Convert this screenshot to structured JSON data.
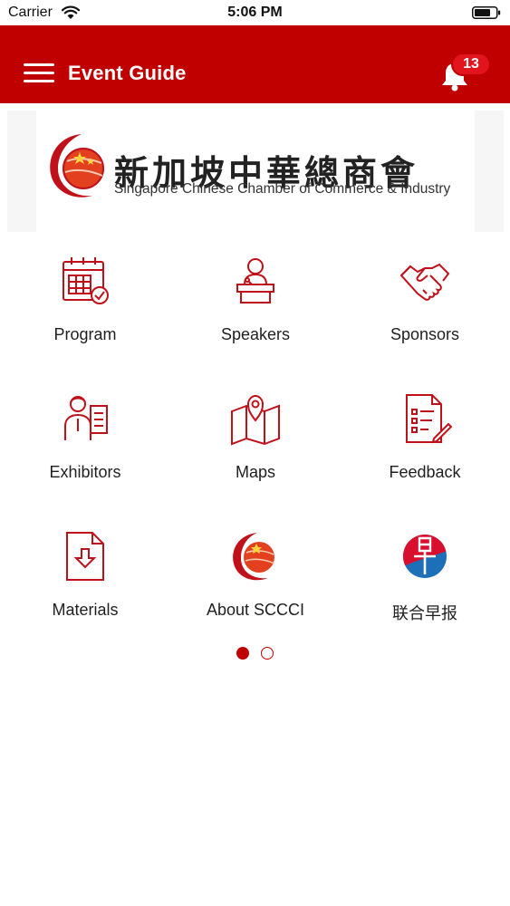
{
  "status_bar": {
    "carrier": "Carrier",
    "time": "5:06 PM"
  },
  "header": {
    "title": "Event Guide",
    "notification_count": "13"
  },
  "banner": {
    "org_name_cn": "新加坡中華總商會",
    "org_name_en": "Singapore Chinese Chamber of Commerce & Industry"
  },
  "menu": [
    {
      "label": "Program",
      "icon": "calendar-icon"
    },
    {
      "label": "Speakers",
      "icon": "speaker-podium-icon"
    },
    {
      "label": "Sponsors",
      "icon": "handshake-icon"
    },
    {
      "label": "Exhibitors",
      "icon": "exhibitor-icon"
    },
    {
      "label": "Maps",
      "icon": "map-pin-icon"
    },
    {
      "label": "Feedback",
      "icon": "feedback-form-icon"
    },
    {
      "label": "Materials",
      "icon": "document-download-icon"
    },
    {
      "label": "About SCCCI",
      "icon": "sccci-logo-icon"
    },
    {
      "label": "联合早报",
      "icon": "zaobao-logo-icon"
    }
  ],
  "pager": {
    "current_page": 1,
    "page_count": 2
  },
  "colors": {
    "brand_red": "#c00000",
    "badge_red": "#e2141e",
    "icon_red": "#c0101a"
  }
}
